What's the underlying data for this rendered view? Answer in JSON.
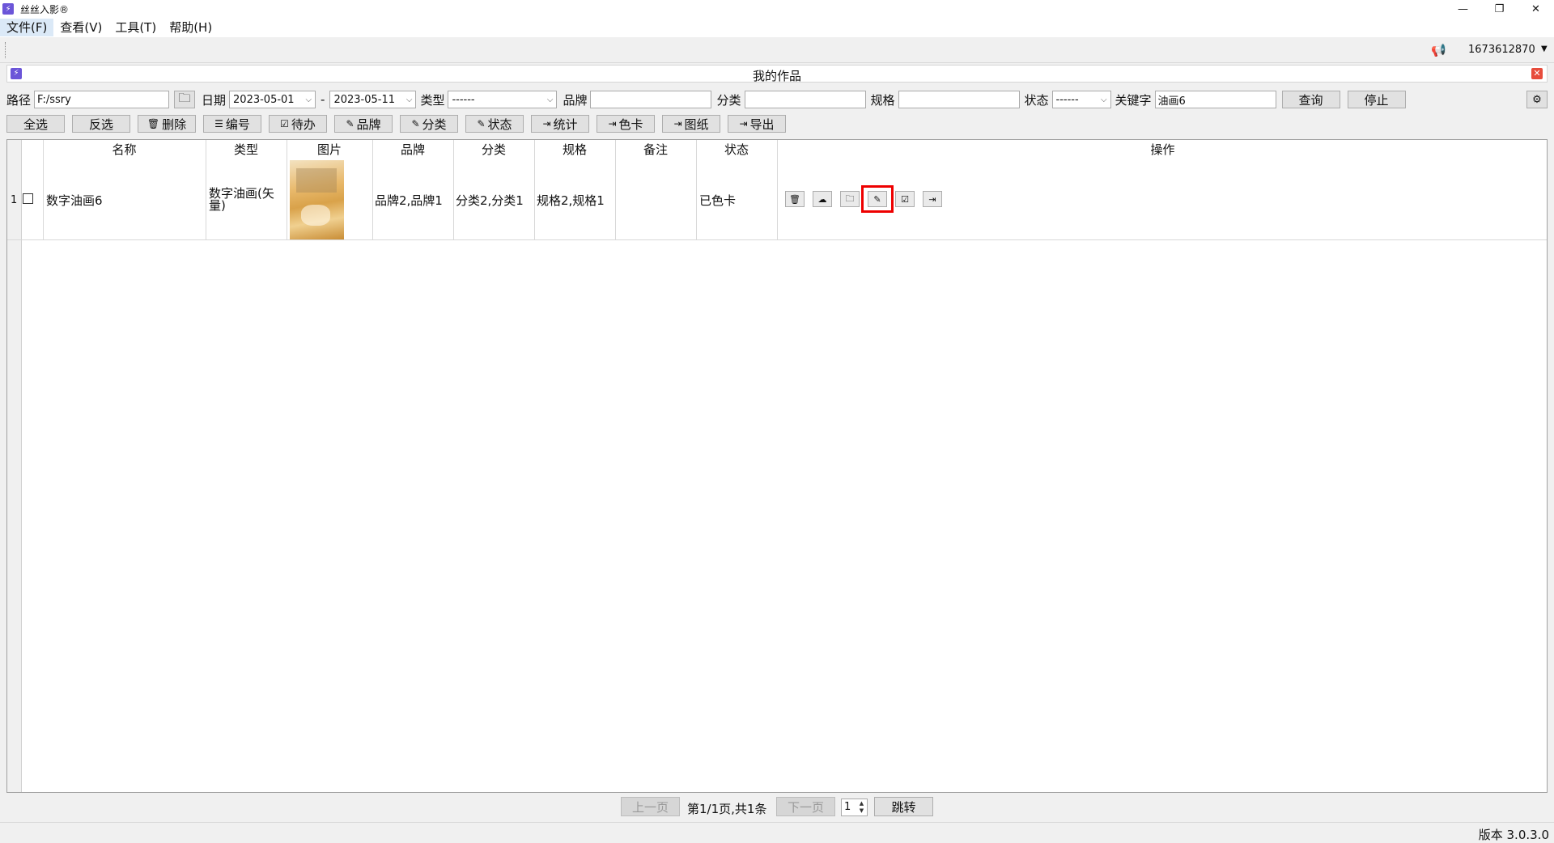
{
  "window": {
    "title": "丝丝入影®",
    "controls": [
      "minimize-icon",
      "restore-icon",
      "close-icon"
    ]
  },
  "menu": [
    {
      "label": "文件(F)"
    },
    {
      "label": "查看(V)"
    },
    {
      "label": "工具(T)"
    },
    {
      "label": "帮助(H)"
    }
  ],
  "user": {
    "id": "1673612870"
  },
  "panel": {
    "title": "我的作品"
  },
  "filters": {
    "path_label": "路径",
    "path_value": "F:/ssry",
    "date_label": "日期",
    "date_from": "2023-05-01",
    "date_sep": "-",
    "date_to": "2023-05-11",
    "type_label": "类型",
    "type_value": "------",
    "brand_label": "品牌",
    "brand_value": "",
    "category_label": "分类",
    "category_value": "",
    "spec_label": "规格",
    "spec_value": "",
    "status_label": "状态",
    "status_value": "------",
    "keyword_label": "关键字",
    "keyword_value": "油画6",
    "query_label": "查询",
    "stop_label": "停止"
  },
  "toolbar": {
    "select_all": "全选",
    "invert": "反选",
    "delete": "删除",
    "number": "编号",
    "todo": "待办",
    "brand": "品牌",
    "category": "分类",
    "status": "状态",
    "stats": "统计",
    "color_card": "色卡",
    "drawing": "图纸",
    "export": "导出"
  },
  "table": {
    "headers": [
      "名称",
      "类型",
      "图片",
      "品牌",
      "分类",
      "规格",
      "备注",
      "状态",
      "操作"
    ],
    "rows": [
      {
        "index": "1",
        "name": "数字油画6",
        "type": "数字油画(矢量)",
        "brand": "品牌2,品牌1",
        "category": "分类2,分类1",
        "spec": "规格2,规格1",
        "note": "",
        "status": "已色卡"
      }
    ],
    "ops": [
      "trash-icon",
      "cloud-icon",
      "folder-icon",
      "edit-icon",
      "clipboard-icon",
      "export-icon"
    ]
  },
  "pager": {
    "prev": "上一页",
    "info": "第1/1页,共1条",
    "next": "下一页",
    "page": "1",
    "jump": "跳转"
  },
  "status": {
    "version": "版本 3.0.3.0"
  }
}
